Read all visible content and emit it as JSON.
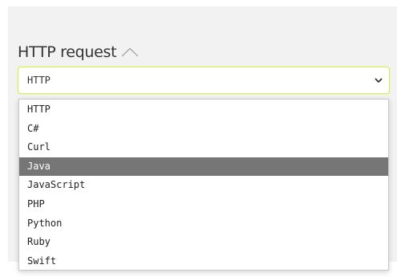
{
  "section": {
    "title": "HTTP request",
    "collapse_icon": "caret-up-icon"
  },
  "select": {
    "value": "HTTP",
    "dropdown_icon": "chevron-down-icon"
  },
  "options": [
    {
      "label": "HTTP",
      "highlighted": false
    },
    {
      "label": "C#",
      "highlighted": false
    },
    {
      "label": "Curl",
      "highlighted": false
    },
    {
      "label": "Java",
      "highlighted": true
    },
    {
      "label": "JavaScript",
      "highlighted": false
    },
    {
      "label": "PHP",
      "highlighted": false
    },
    {
      "label": "Python",
      "highlighted": false
    },
    {
      "label": "Ruby",
      "highlighted": false
    },
    {
      "label": "Swift",
      "highlighted": false
    }
  ],
  "colors": {
    "panel_background": "#f2f2f2",
    "select_border": "#d8e86a",
    "highlight_background": "#767676",
    "highlight_text": "#ffffff"
  }
}
